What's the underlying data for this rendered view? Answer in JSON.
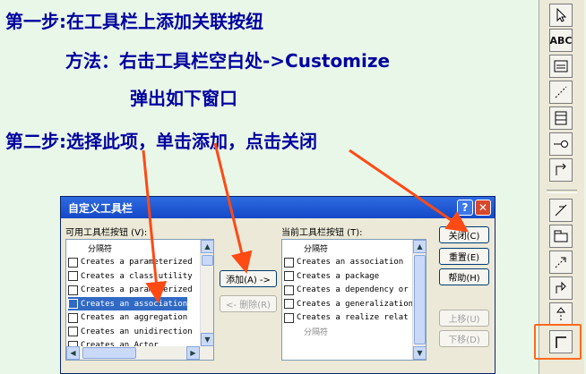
{
  "slide": {
    "step1": "第一步:在工具栏上添加关联按纽",
    "method": "方法：右击工具栏空白处->Customize",
    "popup": "弹出如下窗口",
    "step2": "第二步:选择此项，单击添加，点击关闭"
  },
  "toolbar": {
    "abc_label": "ABC",
    "icons": [
      "selection-arrow-icon",
      "text-abc-icon",
      "note-icon",
      "anchor-line-icon",
      "class-icon",
      "interface-icon",
      "unidirectional-association-icon",
      "association-icon",
      "package-icon",
      "dependency-icon",
      "generalization-icon",
      "realize-icon",
      "association-class-icon"
    ]
  },
  "dialog": {
    "title": "自定义工具栏",
    "help_symbol": "?",
    "close_symbol": "✕",
    "available_label": "可用工具栏按钮 (V):",
    "current_label": "当前工具栏按钮 (T):",
    "available_items": [
      {
        "text": "分隔符",
        "state": "normal"
      },
      {
        "text": "Creates a parameterized",
        "state": "normal"
      },
      {
        "text": "Creates a class utility",
        "state": "normal"
      },
      {
        "text": "Creates a parameterized",
        "state": "normal"
      },
      {
        "text": "Creates an association",
        "state": "selected"
      },
      {
        "text": "Creates an aggregation",
        "state": "normal"
      },
      {
        "text": "Creates an unidirection",
        "state": "normal"
      },
      {
        "text": "Creates an Actor",
        "state": "normal"
      }
    ],
    "current_items": [
      {
        "text": "分隔符",
        "state": "normal"
      },
      {
        "text": "Creates an association",
        "state": "normal"
      },
      {
        "text": "Creates a package",
        "state": "normal"
      },
      {
        "text": "Creates a dependency or",
        "state": "normal"
      },
      {
        "text": "Creates a generalization",
        "state": "normal"
      },
      {
        "text": "Creates a realize relat",
        "state": "normal"
      },
      {
        "text": "分隔符",
        "state": "grey"
      }
    ],
    "add_button": "添加(A) ->",
    "remove_button": "<- 删除(R)",
    "close_button": "关闭(C)",
    "reset_button": "重置(E)",
    "help_button": "帮助(H)",
    "move_up_button": "上移(U)",
    "move_down_button": "下移(D)"
  },
  "colors": {
    "slide_text": "#0000a0",
    "arrow": "#ff4a14",
    "selection": "#316ac5",
    "titlebar": "#1f55d4"
  }
}
